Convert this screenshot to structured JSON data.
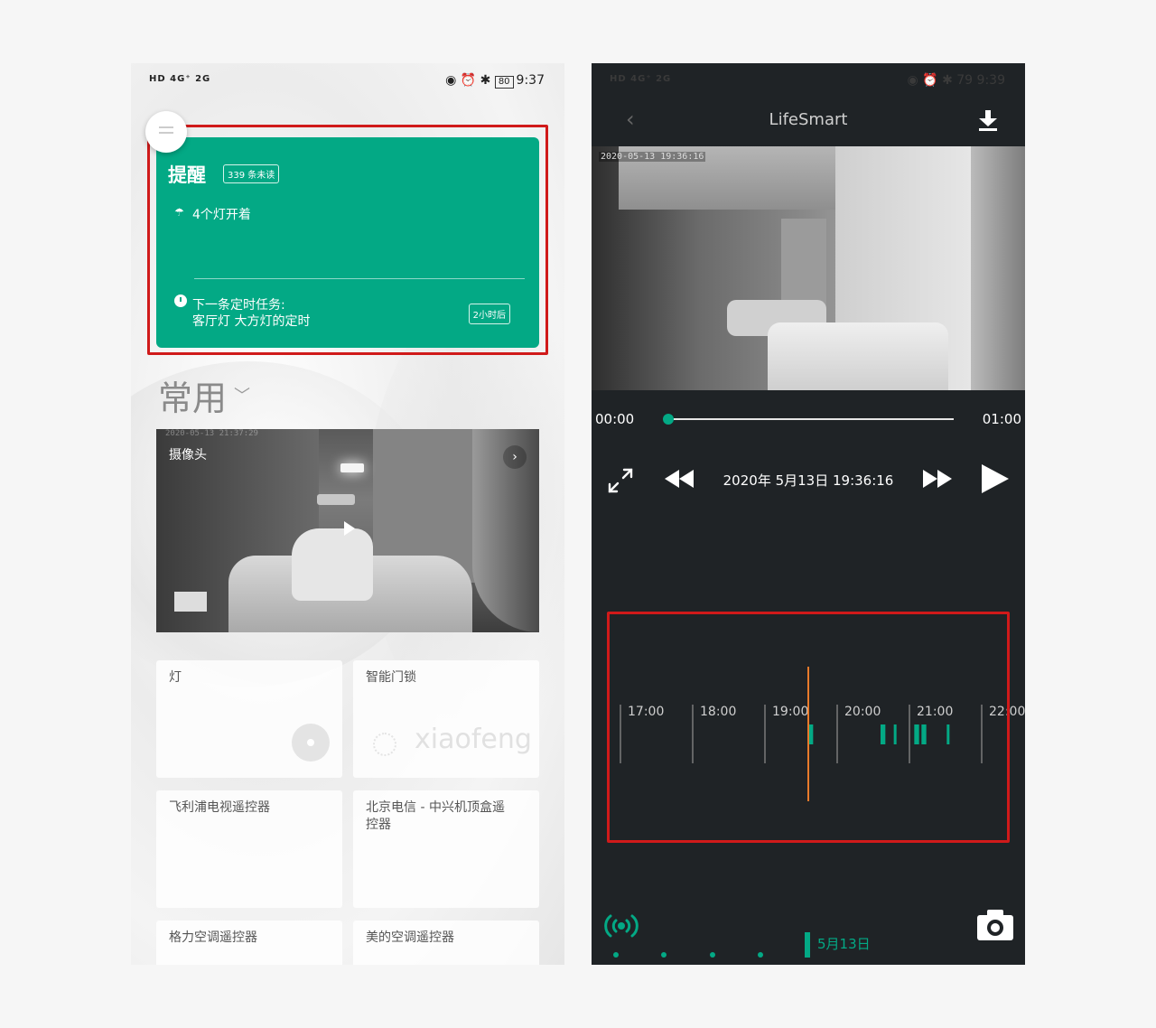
{
  "left": {
    "status_left": "HD 4G⁺ 2G",
    "battery": "80",
    "time": "9:37",
    "reminder": {
      "title": "提醒",
      "unread_badge": "339 条未读",
      "lights_status": "4个灯开着",
      "next_task_label": "下一条定时任务:",
      "next_task_name": "客厅灯 大方灯的定时",
      "time_badge": "2小时后"
    },
    "section_title": "常用",
    "camera": {
      "title": "摄像头",
      "timestamp": "2020-05-13 21:37:29"
    },
    "devices": [
      {
        "label": "灯"
      },
      {
        "label": "智能门锁",
        "user": "xiaofeng"
      },
      {
        "label": "飞利浦电视遥控器"
      },
      {
        "label": "北京电信 - 中兴机顶盒遥控器"
      },
      {
        "label": "格力空调遥控器"
      },
      {
        "label": "美的空调遥控器"
      }
    ]
  },
  "right": {
    "status_left": "HD 4G⁺ 2G",
    "battery": "79",
    "time": "9:39",
    "app_title": "LifeSmart",
    "video_timestamp": "2020-05-13 19:36:16",
    "start_time": "00:00",
    "end_time": "01:00",
    "playback_time": "2020年 5月13日 19:36:16",
    "timeline": {
      "hours": [
        "17:00",
        "18:00",
        "19:00",
        "20:00",
        "21:00",
        "22:00"
      ],
      "cursor": "19:36",
      "segments": [
        {
          "start": "19:36",
          "end": "19:40"
        },
        {
          "start": "20:36",
          "end": "20:40"
        },
        {
          "start": "20:47",
          "end": "20:49"
        },
        {
          "start": "21:04",
          "end": "21:08"
        },
        {
          "start": "21:10",
          "end": "21:14"
        },
        {
          "start": "21:31",
          "end": "21:33"
        }
      ],
      "accent_color": "#03a985",
      "cursor_color": "#e87a2b"
    },
    "date_label": "5月13日"
  },
  "colors": {
    "accent": "#03a985",
    "highlight": "#d01a1a"
  }
}
